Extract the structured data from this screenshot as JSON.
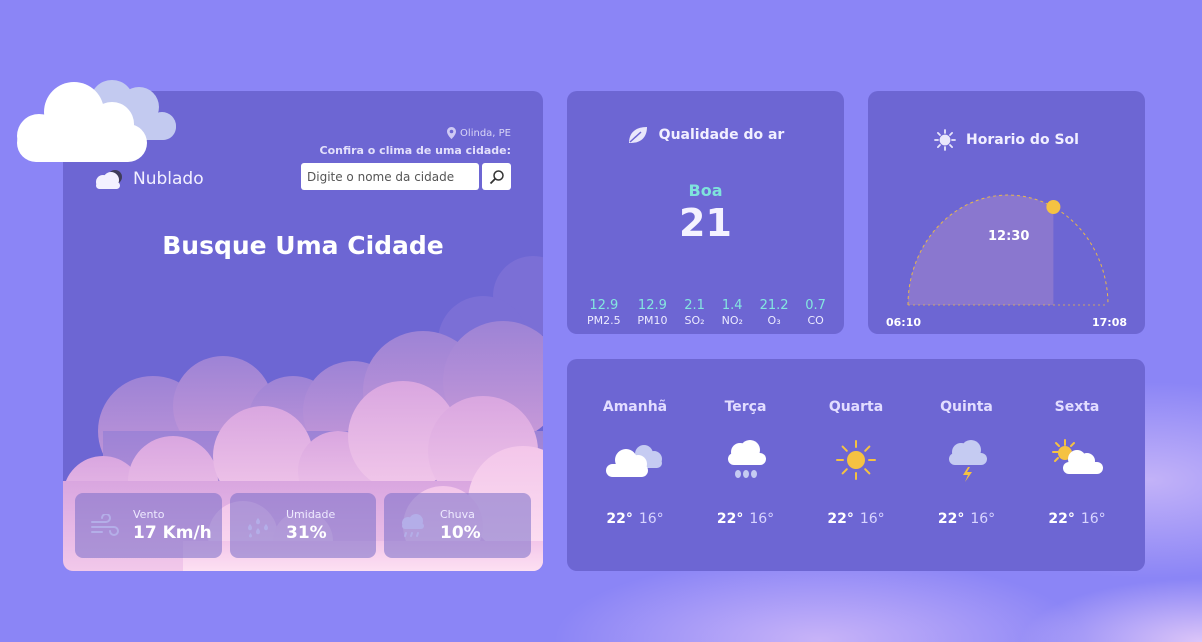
{
  "location": "Olinda, PE",
  "search": {
    "hint": "Confira o clima de uma cidade:",
    "placeholder": "Digite o nome da cidade",
    "button_icon": "search-icon"
  },
  "condition": {
    "label": "Nublado",
    "icon": "cloud-icon"
  },
  "city_title": "Busque Uma Cidade",
  "stats": [
    {
      "label": "Vento",
      "value": "17 Km/h",
      "icon": "wind-icon"
    },
    {
      "label": "Umidade",
      "value": "31%",
      "icon": "humidity-icon"
    },
    {
      "label": "Chuva",
      "value": "10%",
      "icon": "rain-icon"
    }
  ],
  "air_quality": {
    "title": "Qualidade do ar",
    "icon": "leaf-icon",
    "status": "Boa",
    "index": "21",
    "pollutants": [
      {
        "value": "12.9",
        "name": "PM2.5"
      },
      {
        "value": "12.9",
        "name": "PM10"
      },
      {
        "value": "2.1",
        "name": "SO₂"
      },
      {
        "value": "1.4",
        "name": "NO₂"
      },
      {
        "value": "21.2",
        "name": "O₃"
      },
      {
        "value": "0.7",
        "name": "CO"
      }
    ]
  },
  "sun": {
    "title": "Horario do Sol",
    "icon": "sun-icon",
    "current_time": "12:30",
    "sunrise": "06:10",
    "sunset": "17:08",
    "progress": 0.65
  },
  "forecast": [
    {
      "day": "Amanhã",
      "high": "22°",
      "low": "16°",
      "icon": "cloudy-icon"
    },
    {
      "day": "Terça",
      "high": "22°",
      "low": "16°",
      "icon": "rain-cloud-icon"
    },
    {
      "day": "Quarta",
      "high": "22°",
      "low": "16°",
      "icon": "sunny-icon"
    },
    {
      "day": "Quinta",
      "high": "22°",
      "low": "16°",
      "icon": "thunder-cloud-icon"
    },
    {
      "day": "Sexta",
      "high": "22°",
      "low": "16°",
      "icon": "partly-cloudy-icon"
    }
  ],
  "colors": {
    "background": "#8b85f6",
    "card": "#6d66d3",
    "accent_teal": "#7fe3dc",
    "sun_yellow": "#f5c242"
  }
}
